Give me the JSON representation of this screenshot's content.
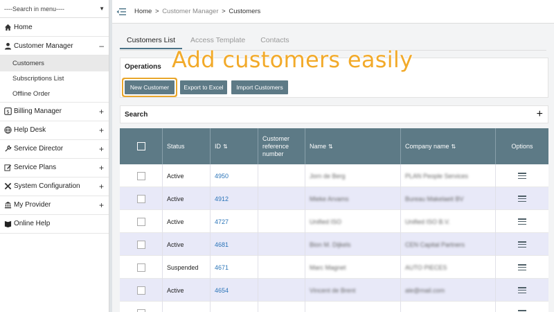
{
  "sidebar": {
    "search_label": "----Search in menu----",
    "items": [
      {
        "label": "Home",
        "icon": "home-icon",
        "toggle": ""
      },
      {
        "label": "Customer Manager",
        "icon": "user-icon",
        "toggle": "–"
      },
      {
        "label": "Billing Manager",
        "icon": "dollar-icon",
        "toggle": "+"
      },
      {
        "label": "Help Desk",
        "icon": "globe-icon",
        "toggle": "+"
      },
      {
        "label": "Service Director",
        "icon": "wrench-icon",
        "toggle": "+"
      },
      {
        "label": "Service Plans",
        "icon": "pencil-icon",
        "toggle": "+"
      },
      {
        "label": "System Configuration",
        "icon": "tools-icon",
        "toggle": "+"
      },
      {
        "label": "My Provider",
        "icon": "bank-icon",
        "toggle": "+"
      },
      {
        "label": "Online Help",
        "icon": "book-icon",
        "toggle": ""
      }
    ],
    "subitems": [
      {
        "label": "Customers"
      },
      {
        "label": "Subscriptions List"
      },
      {
        "label": "Offline Order"
      }
    ]
  },
  "breadcrumb": {
    "home": "Home",
    "sep": ">",
    "section": "Customer Manager",
    "current": "Customers"
  },
  "tabs": [
    {
      "label": "Customers List"
    },
    {
      "label": "Access Template"
    },
    {
      "label": "Contacts"
    }
  ],
  "operations": {
    "title": "Operations",
    "buttons": [
      {
        "label": "New Customer"
      },
      {
        "label": "Export to Excel"
      },
      {
        "label": "Import Customers"
      }
    ]
  },
  "search": {
    "title": "Search",
    "expand_glyph": "+"
  },
  "overlay_text": "Add customers easily",
  "table": {
    "headers": {
      "status": "Status",
      "id": "ID",
      "ref": "Customer reference number",
      "name": "Name",
      "company": "Company name",
      "options": "Options",
      "sort_glyph": "⇅"
    },
    "rows": [
      {
        "status": "Active",
        "id": "4950",
        "name": "Jorn de Berg",
        "company": "PLAN People Services"
      },
      {
        "status": "Active",
        "id": "4912",
        "name": "Mieke Arvams",
        "company": "Bureau Makelaeit BV"
      },
      {
        "status": "Active",
        "id": "4727",
        "name": "Unified ISO",
        "company": "Unified ISO B.V."
      },
      {
        "status": "Active",
        "id": "4681",
        "name": "Bion M. Dijkels",
        "company": "CEN Capital Partners"
      },
      {
        "status": "Suspended",
        "id": "4671",
        "name": "Marc Magnet",
        "company": "AUTO PIECES"
      },
      {
        "status": "Active",
        "id": "4654",
        "name": "Vincent de Brent",
        "company": "ale@mail.com"
      },
      {
        "status": "",
        "id": "",
        "name": "",
        "company": ""
      }
    ]
  },
  "colors": {
    "accent": "#5d7a86",
    "link": "#2a74b8",
    "overlay": "#f2aa2a",
    "row_alt": "#e8e9f8"
  }
}
